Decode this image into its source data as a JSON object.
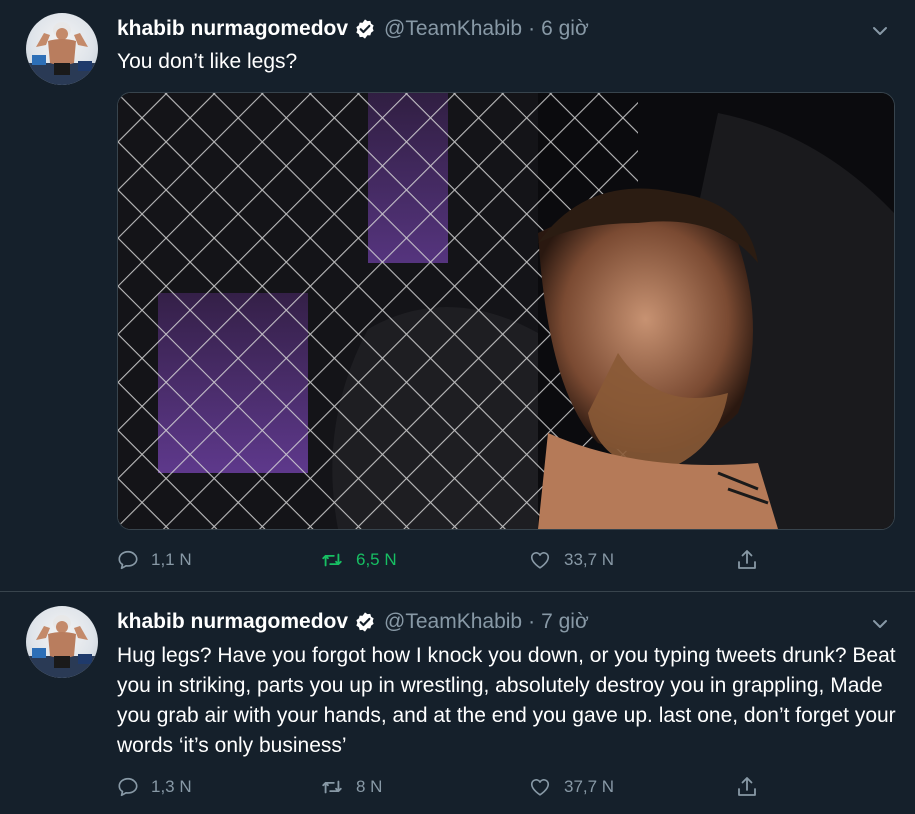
{
  "colors": {
    "background": "#15202b",
    "muted": "#8899a6",
    "retweet_active": "#17bf63",
    "verified": "#ffffff"
  },
  "tweets": [
    {
      "author_name": "khabib nurmagomedov",
      "handle": "@TeamKhabib",
      "separator": "·",
      "time": "6 giờ",
      "text": "You don’t like legs?",
      "has_media": true,
      "replies": "1,1 N",
      "retweets": "6,5 N",
      "retweeted": true,
      "likes": "33,7 N",
      "icons": [
        "verified-badge-icon",
        "chevron-down-icon",
        "reply-icon",
        "retweet-icon",
        "heart-icon",
        "share-icon"
      ]
    },
    {
      "author_name": "khabib nurmagomedov",
      "handle": "@TeamKhabib",
      "separator": "·",
      "time": "7 giờ",
      "text": "Hug legs? Have you forgot how I knock you down, or you typing tweets drunk? Beat you in striking, parts you up in wrestling, absolutely destroy you in grappling, Made you grab air with your hands, and at the end you gave up.  last one, don’t forget your words ‘it’s only business’",
      "has_media": false,
      "replies": "1,3 N",
      "retweets": "8 N",
      "retweeted": false,
      "likes": "37,7 N",
      "icons": [
        "verified-badge-icon",
        "chevron-down-icon",
        "reply-icon",
        "retweet-icon",
        "heart-icon",
        "share-icon"
      ]
    }
  ]
}
